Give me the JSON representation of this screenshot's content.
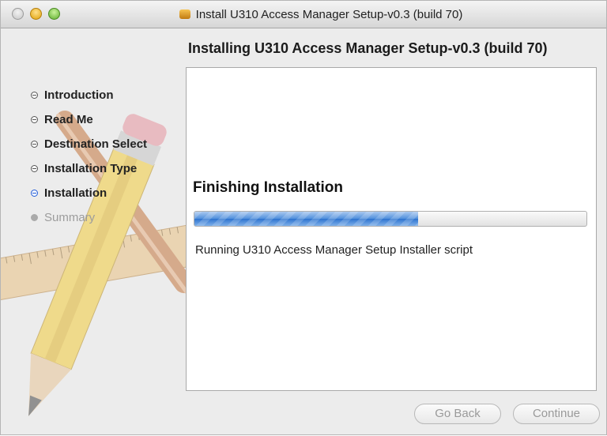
{
  "window": {
    "title": "Install U310 Access Manager Setup-v0.3 (build 70)"
  },
  "installer": {
    "heading": "Installing U310 Access Manager Setup-v0.3 (build 70)",
    "steps": [
      {
        "label": "Introduction",
        "state": "done"
      },
      {
        "label": "Read Me",
        "state": "done"
      },
      {
        "label": "Destination Select",
        "state": "done"
      },
      {
        "label": "Installation Type",
        "state": "done"
      },
      {
        "label": "Installation",
        "state": "current"
      },
      {
        "label": "Summary",
        "state": "future"
      }
    ],
    "status_title": "Finishing Installation",
    "status_detail": "Running U310 Access Manager Setup Installer script",
    "progress_fraction": 0.57
  },
  "buttons": {
    "go_back": "Go Back",
    "continue": "Continue"
  },
  "colors": {
    "current_step": "#1f5ad8",
    "progress_fill": "#4f8fdc"
  }
}
